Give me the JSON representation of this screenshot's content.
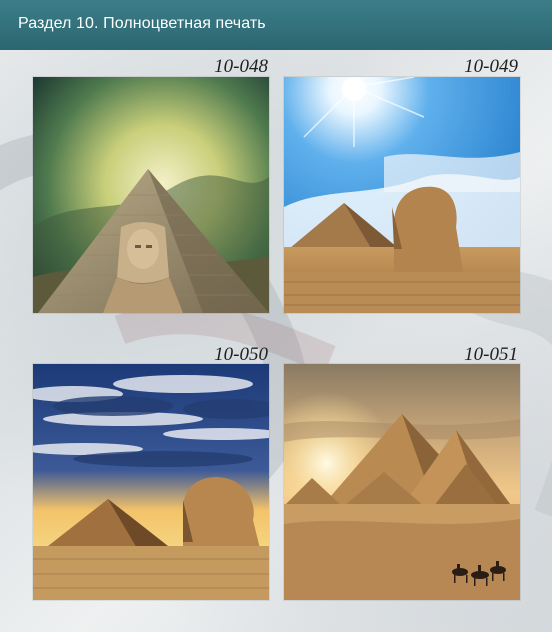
{
  "header": {
    "title": "Раздел 10. Полноцветная печать"
  },
  "catalog": {
    "items": [
      {
        "code": "10-048",
        "image": "sphinx-in-front-of-pyramid-stormy-sky"
      },
      {
        "code": "10-049",
        "image": "sphinx-and-pyramid-bright-sun-blue-sky"
      },
      {
        "code": "10-050",
        "image": "sphinx-and-pyramid-sunset-clouds"
      },
      {
        "code": "10-051",
        "image": "giza-pyramids-desert-with-camel-riders"
      }
    ]
  }
}
